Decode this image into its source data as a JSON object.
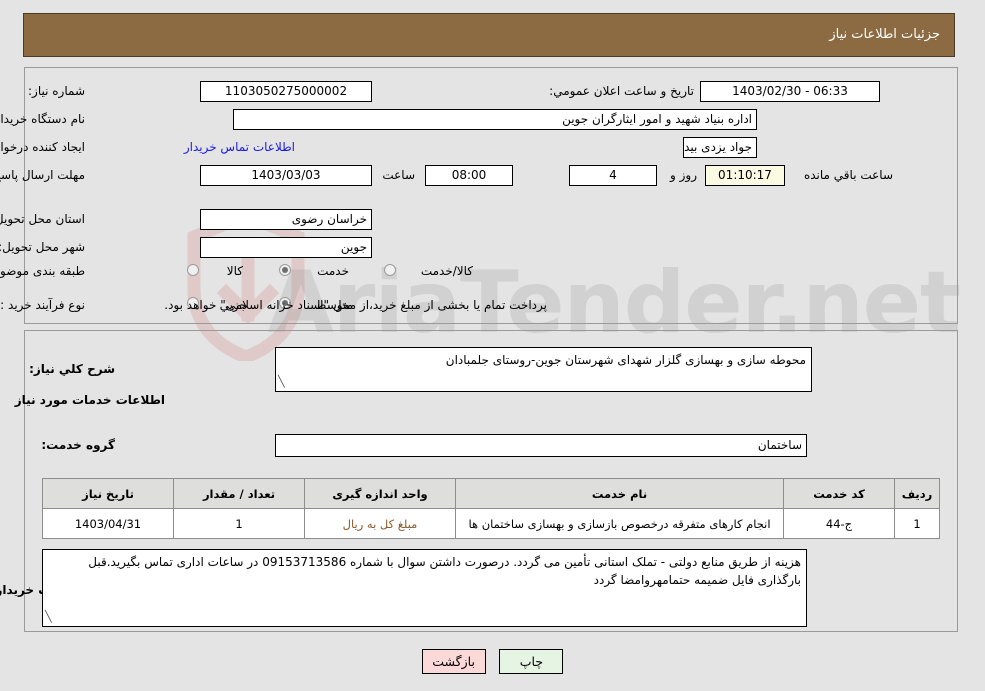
{
  "header": {
    "title": "جزئیات اطلاعات نیاز",
    "bar_color": "#8c6b43"
  },
  "watermark": {
    "text": "AriaTender.net"
  },
  "form": {
    "need_number": {
      "label": "شماره نیاز:",
      "value": "1103050275000002"
    },
    "public_announce": {
      "label": "تاریخ و ساعت اعلان عمومي:",
      "value": "06:33 - 1403/02/30"
    },
    "buyer_org": {
      "label": "نام دستگاه خریدار:",
      "value": "اداره بنیاد شهید و امور ایثارگران جوین"
    },
    "creator": {
      "label": "ایجاد کننده درخواست:",
      "value": "جواد یزدی بیدی کارشناس اداری و مالی اداره بنیاد شهید و امور ایثارگران جوین",
      "contact_link": "اطلاعات تماس خریدار"
    },
    "deadline": {
      "label": "مهلت ارسال پاسخ: تا تاریخ:",
      "date": "1403/03/03",
      "hour_label": "ساعت",
      "hour": "08:00",
      "days": "4",
      "days_suffix": "روز و",
      "timer": "01:10:17",
      "timer_suffix": "ساعت باقي مانده"
    },
    "province": {
      "label": "استان محل تحویل:",
      "value": "خراسان رضوی"
    },
    "city": {
      "label": "شهر محل تحویل:",
      "value": "جوین"
    },
    "category": {
      "label": "طبقه بندی موضوعی:",
      "options": [
        "کالا",
        "خدمت",
        "کالا/خدمت"
      ],
      "selected": "خدمت"
    },
    "process_type": {
      "label": "نوع فرآیند خرید :",
      "options": [
        "جزیي",
        "متوسط"
      ],
      "selected": "متوسط",
      "note": "پرداخت تمام یا بخشی از مبلغ خرید،از محل \"اسناد خزانه اسلامی\" خواهد بود."
    }
  },
  "details": {
    "summary_label": "شرح کلي نیاز:",
    "summary_value": "محوطه سازی و بهسازی گلزار شهدای شهرستان جوین-روستای جلمبادان",
    "services_heading": "اطلاعات خدمات مورد نیاز",
    "service_group_label": "گروه خدمت:",
    "service_group_value": "ساختمان"
  },
  "table": {
    "columns": [
      "ردیف",
      "کد خدمت",
      "نام خدمت",
      "واحد اندازه گیری",
      "تعداد / مقدار",
      "تاریخ نیاز"
    ],
    "rows": [
      {
        "row": "1",
        "code": "ج-44",
        "name": "انجام کارهای متفرقه درخصوص بازسازی و بهسازی ساختمان ها",
        "unit": "مبلغ کل به ریال",
        "qty": "1",
        "date": "1403/04/31"
      }
    ]
  },
  "buyer_notes": {
    "label": "توضیحات خریدار:",
    "value": "هزینه از طریق منابع دولتی - تملک استانی تأمین می گردد. درصورت داشتن سوال با شماره 09153713586 در ساعات اداری تماس بگیرید.قبل بارگذاری فایل ضمیمه حتمامهروامضا گردد"
  },
  "buttons": {
    "print": "چاپ",
    "back": "بازگشت"
  }
}
